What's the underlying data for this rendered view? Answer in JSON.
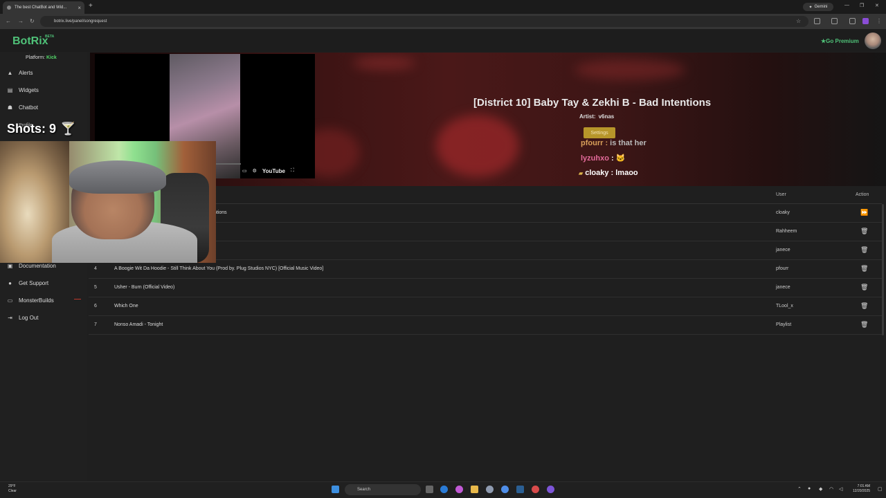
{
  "browser": {
    "tab_title": "The best ChatBot and Wid...",
    "url": "botrix.live/panel/songrequest",
    "gemini_label": "Gemini"
  },
  "app": {
    "logo": "BotRix",
    "beta": "BETA",
    "platform_label": "Platform:",
    "platform_value": "Kick",
    "go_premium": "Go Premium"
  },
  "sidebar": {
    "items": [
      {
        "label": "Alerts",
        "icon": "warning-icon"
      },
      {
        "label": "Widgets",
        "icon": "widgets-icon"
      },
      {
        "label": "Chatbot",
        "icon": "robot-icon"
      },
      {
        "label": "Documentation",
        "icon": "book-icon"
      },
      {
        "label": "Get Support",
        "icon": "support-icon"
      },
      {
        "label": "MonsterBuilds",
        "icon": "monitor-icon"
      },
      {
        "label": "Log Out",
        "icon": "logout-icon"
      }
    ],
    "profile_peek": "Profile"
  },
  "now_playing": {
    "title": "[District 10] Baby Tay & Zekhi B - Bad Intentions",
    "artist_label": "Artist:",
    "artist": "v6nas",
    "settings_label": "Settings",
    "youtube_label": "YouTube",
    "chat": [
      {
        "user": "pfourr",
        "sep": " : ",
        "message": "is that her",
        "color": "#d9a05a"
      },
      {
        "user": "lyzuhxo",
        "sep": " :",
        "message": "",
        "color": "#e46a9a"
      },
      {
        "user": "cloaky",
        "sep": " : ",
        "message": "lmaoo",
        "color": "#ffffff"
      }
    ]
  },
  "table": {
    "headers": {
      "user": "User",
      "action": "Action"
    },
    "rows": [
      {
        "num": "",
        "title": "ntions",
        "user": "cloaky",
        "action": "skip-icon"
      },
      {
        "num": "",
        "title": "",
        "user": "Rahheem",
        "action": "trash-icon"
      },
      {
        "num": "",
        "title": "",
        "user": "janece",
        "action": "trash-icon"
      },
      {
        "num": "4",
        "title": "A Boogie Wit Da Hoodie - Still Think About You (Prod by. Plug Studios NYC) [Official Music Video]",
        "user": "pfourr",
        "action": "trash-icon"
      },
      {
        "num": "5",
        "title": "Usher - Burn (Official Video)",
        "user": "janece",
        "action": "trash-icon"
      },
      {
        "num": "6",
        "title": "Which One",
        "user": "TLool_x",
        "action": "trash-icon"
      },
      {
        "num": "7",
        "title": "Nonso Amadi - Tonight",
        "user": "Playlist",
        "action": "trash-icon"
      }
    ]
  },
  "overlay": {
    "shots_label": "Shots: 9"
  },
  "taskbar": {
    "weather_temp": "29°F",
    "weather_desc": "Clear",
    "search_placeholder": "Search",
    "time": "7:01 AM",
    "date": "12/20/2025"
  }
}
